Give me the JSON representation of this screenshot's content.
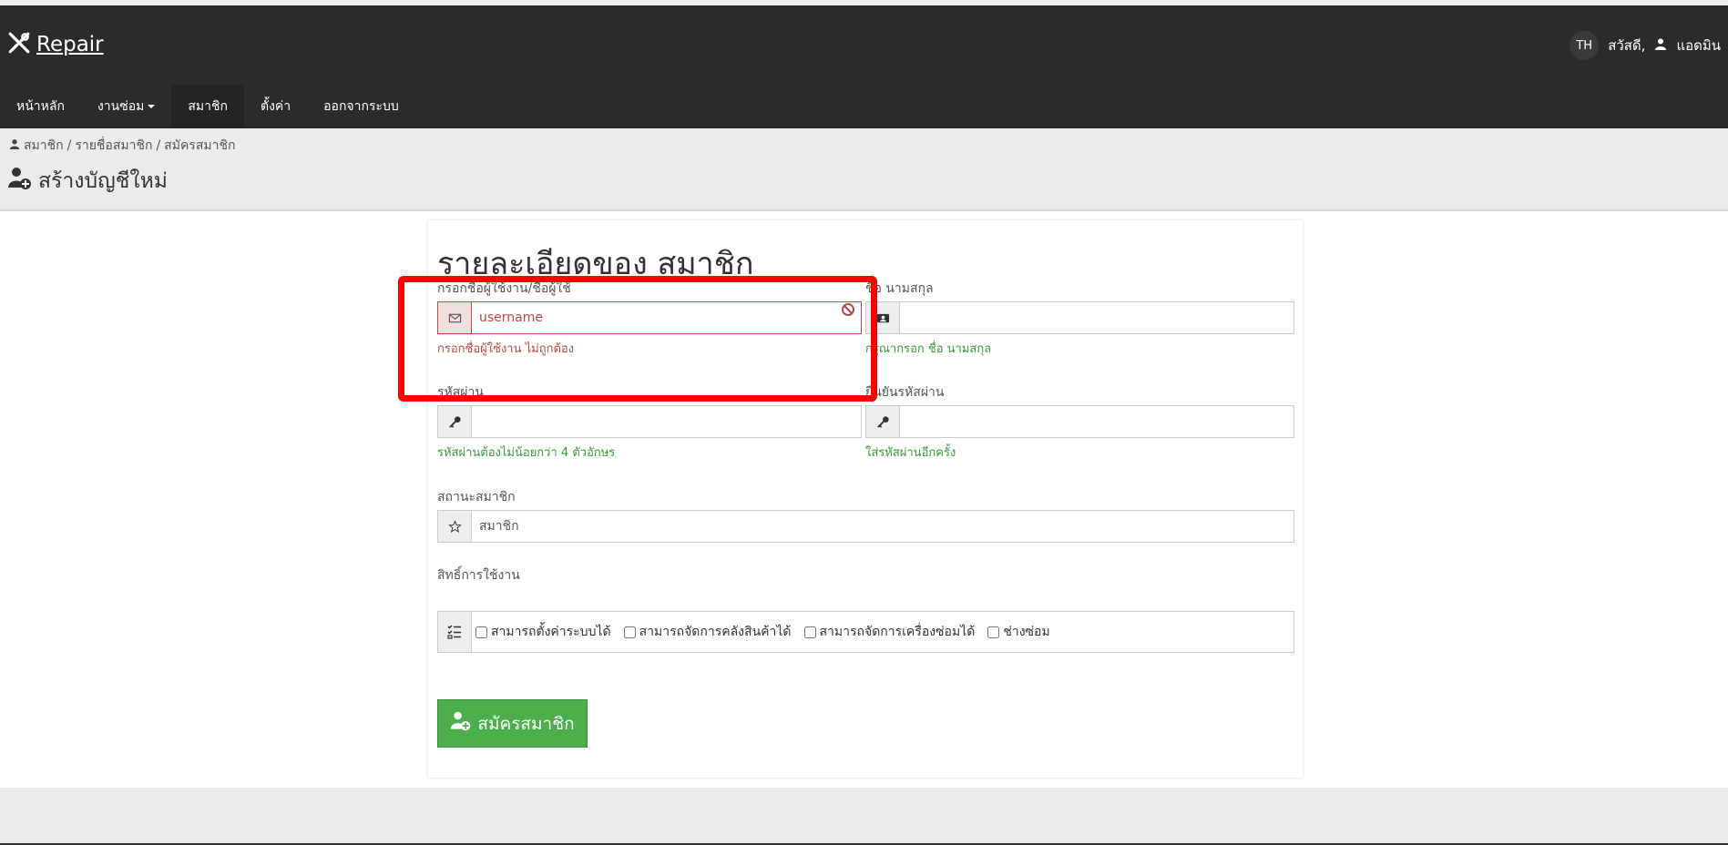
{
  "header": {
    "brand": "Repair",
    "lang": "TH",
    "greeting": "สวัสดี,",
    "username": "แอดมิน"
  },
  "nav": {
    "items": [
      {
        "label": "หน้าหลัก"
      },
      {
        "label": "งานซ่อม"
      },
      {
        "label": "สมาชิก"
      },
      {
        "label": "ตั้งค่า"
      },
      {
        "label": "ออกจากระบบ"
      }
    ]
  },
  "breadcrumb": {
    "items": [
      "สมาชิก",
      "รายชื่อสมาชิก",
      "สมัครสมาชิก"
    ],
    "separator": "/"
  },
  "page": {
    "title": "สร้างบัญชีใหม่"
  },
  "form": {
    "title": "รายละเอียดของ สมาชิก",
    "username": {
      "label": "กรอกชื่อผู้ใช้งาน/ชื่อผู้ใช้",
      "placeholder": "username",
      "value": "",
      "error": "กรอกชื่อผู้ใช้งาน ไม่ถูกต้อง"
    },
    "fullname": {
      "label": "ชื่อ นามสกุล",
      "value": "",
      "help": "กรุณากรอก ชื่อ นามสกุล"
    },
    "password": {
      "label": "รหัสผ่าน",
      "value": "",
      "help": "รหัสผ่านต้องไม่น้อยกว่า 4 ตัวอักษร"
    },
    "confirm_password": {
      "label": "ยืนยันรหัสผ่าน",
      "value": "",
      "help": "ใส่รหัสผ่านอีกครั้ง"
    },
    "status": {
      "label": "สถานะสมาชิก",
      "value": "สมาชิก"
    },
    "permissions": {
      "label": "สิทธิ์การใช้งาน",
      "items": [
        {
          "label": "สามารถตั้งค่าระบบได้",
          "checked": false
        },
        {
          "label": "สามารถจัดการคลังสินค้าได้",
          "checked": false
        },
        {
          "label": "สามารถจัดการเครื่องซ่อมได้",
          "checked": false
        },
        {
          "label": "ช่างซ่อม",
          "checked": false
        }
      ]
    },
    "submit_label": "สมัครสมาชิก"
  },
  "colors": {
    "topbar": "#2b2b2b",
    "error": "#b94a48",
    "success": "#3c9a3c",
    "submit": "#4cae4c",
    "highlight": "#ff0000"
  }
}
